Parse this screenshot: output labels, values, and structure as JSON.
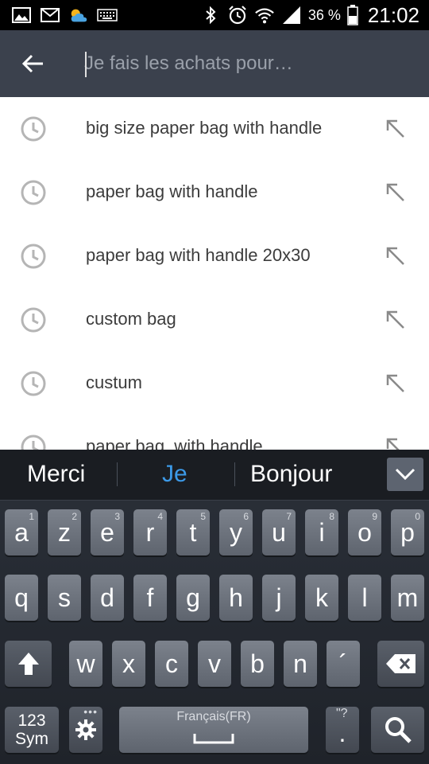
{
  "status_bar": {
    "icons_left": [
      "gallery-icon",
      "gmail-icon",
      "weather-icon",
      "keyboard-icon"
    ],
    "icons_right": [
      "bluetooth-icon",
      "alarm-icon",
      "wifi-icon",
      "signal-icon",
      "battery-icon"
    ],
    "battery": "36 %",
    "time": "21:02"
  },
  "search": {
    "placeholder": "Je fais les achats pour…"
  },
  "suggestions": [
    {
      "label": "big size paper bag with handle"
    },
    {
      "label": "paper bag with handle"
    },
    {
      "label": "paper bag with handle 20x30"
    },
    {
      "label": "custom bag"
    },
    {
      "label": "custum"
    },
    {
      "label": "paper bag  with handle"
    }
  ],
  "keyboard": {
    "predictions": [
      "Merci",
      "Je",
      "Bonjour"
    ],
    "row1": [
      {
        "l": "a",
        "n": "1"
      },
      {
        "l": "z",
        "n": "2"
      },
      {
        "l": "e",
        "n": "3"
      },
      {
        "l": "r",
        "n": "4"
      },
      {
        "l": "t",
        "n": "5"
      },
      {
        "l": "y",
        "n": "6"
      },
      {
        "l": "u",
        "n": "7"
      },
      {
        "l": "i",
        "n": "8"
      },
      {
        "l": "o",
        "n": "9"
      },
      {
        "l": "p",
        "n": "0"
      }
    ],
    "row2": [
      "q",
      "s",
      "d",
      "f",
      "g",
      "h",
      "j",
      "k",
      "l",
      "m"
    ],
    "row3": [
      "w",
      "x",
      "c",
      "v",
      "b",
      "n",
      "´"
    ],
    "sym_label": "123\nSym",
    "sym_line1": "123",
    "sym_line2": "Sym",
    "space_label": "Français(FR)",
    "period_label": ".",
    "period_hint": "\"?"
  },
  "colors": {
    "header_bg": "#3b414d",
    "accent_prediction": "#3c9ae8",
    "list_text": "#3c3c3c",
    "icon_gray": "#b5b5b5"
  }
}
